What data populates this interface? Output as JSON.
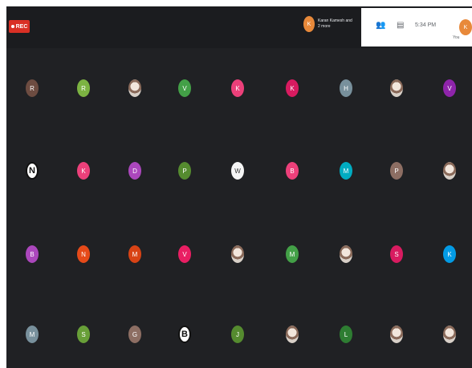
{
  "recording": {
    "label": "REC",
    "color": "#d93025"
  },
  "presenter": {
    "avatar_letter": "K",
    "text": "Karan Kamesh and 2 more",
    "color": "#e8893a"
  },
  "toolbar": {
    "time": "5:34 PM",
    "me_letter": "K",
    "me_label": "You",
    "icons": [
      "people-icon",
      "chat-icon"
    ]
  },
  "participants": [
    [
      {
        "letter": "R",
        "color": "#6d4c41"
      },
      {
        "letter": "R",
        "color": "#7cb342"
      },
      {
        "letter": "",
        "color": "photo"
      },
      {
        "letter": "V",
        "color": "#43a047"
      },
      {
        "letter": "K",
        "color": "#ec407a"
      },
      {
        "letter": "K",
        "color": "#d81b60"
      },
      {
        "letter": "H",
        "color": "#78909c"
      },
      {
        "letter": "",
        "color": "photo"
      },
      {
        "letter": "V",
        "color": "#8e24aa"
      }
    ],
    [
      {
        "letter": "N",
        "color": "logo"
      },
      {
        "letter": "K",
        "color": "#ec407a"
      },
      {
        "letter": "D",
        "color": "#ab47bc"
      },
      {
        "letter": "P",
        "color": "#558b2f"
      },
      {
        "letter": "W",
        "color": "#f5f5f5"
      },
      {
        "letter": "B",
        "color": "#ec407a"
      },
      {
        "letter": "M",
        "color": "#00acc1"
      },
      {
        "letter": "P",
        "color": "#8d6e63"
      },
      {
        "letter": "",
        "color": "photo"
      }
    ],
    [
      {
        "letter": "B",
        "color": "#ab47bc"
      },
      {
        "letter": "N",
        "color": "#e64a19"
      },
      {
        "letter": "M",
        "color": "#d84315"
      },
      {
        "letter": "V",
        "color": "#e91e63"
      },
      {
        "letter": "",
        "color": "photo"
      },
      {
        "letter": "M",
        "color": "#43a047"
      },
      {
        "letter": "",
        "color": "photo"
      },
      {
        "letter": "S",
        "color": "#d81b60"
      },
      {
        "letter": "K",
        "color": "#039be5"
      }
    ],
    [
      {
        "letter": "M",
        "color": "#78909c"
      },
      {
        "letter": "S",
        "color": "#689f38"
      },
      {
        "letter": "G",
        "color": "#8d6e63"
      },
      {
        "letter": "B",
        "color": "logo"
      },
      {
        "letter": "J",
        "color": "#558b2f"
      },
      {
        "letter": "",
        "color": "photo"
      },
      {
        "letter": "L",
        "color": "#2e7d32"
      },
      {
        "letter": "",
        "color": "photo"
      },
      {
        "letter": "",
        "color": "photo"
      }
    ]
  ]
}
